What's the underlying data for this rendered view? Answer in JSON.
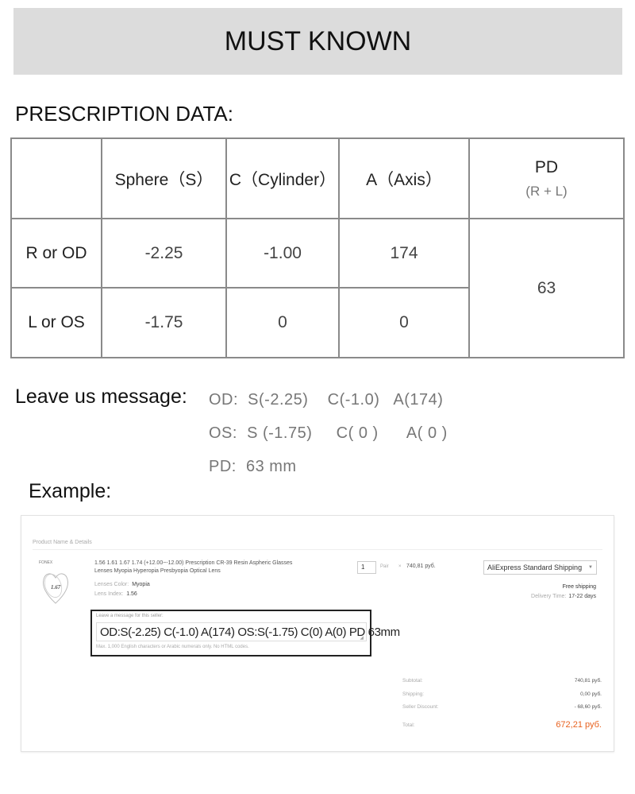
{
  "banner": {
    "title": "MUST KNOWN"
  },
  "prescription": {
    "section_title": "PRESCRIPTION DATA:",
    "headers": {
      "corner": "",
      "sphere": "Sphere（S）",
      "cylinder": "C（Cylinder）",
      "axis": "A（Axis）",
      "pd": "PD",
      "pd_sub": "(R + L)"
    },
    "rows": [
      {
        "label": "R or OD",
        "sphere": "-2.25",
        "cylinder": "-1.00",
        "axis": "174"
      },
      {
        "label": "L or OS",
        "sphere": "-1.75",
        "cylinder": "0",
        "axis": "0"
      }
    ],
    "pd_value": "63"
  },
  "message_guide": {
    "label": "Leave us message:",
    "lines": [
      "OD:  S(-2.25)    C(-1.0)   A(174)",
      "OS:  S (-1.75)     C( 0 )      A( 0 )",
      "PD:  63 mm"
    ]
  },
  "example": {
    "label": "Example:",
    "section_header": "Product Name & Details",
    "thumbnail": {
      "brand": "FONEX",
      "index_text": "1.67"
    },
    "product_title": "1.56 1.61 1.67 1.74 (+12.00~-12.00) Prescription CR-39 Resin Aspheric Glasses Lenses Myopia Hyperopia Presbyopia Optical Lens",
    "attributes": [
      {
        "key": "Lenses Color:",
        "value": "Myopia"
      },
      {
        "key": "Lens Index:",
        "value": "1.56"
      }
    ],
    "quantity": "1",
    "unit": "Pair",
    "times": "×",
    "unit_price": "740,81 руб.",
    "shipping_method": "AliExpress Standard Shipping",
    "free_shipping": "Free shipping",
    "delivery_time_label": "Delivery Time:",
    "delivery_time_value": "17-22 days",
    "message_box": {
      "label": "Leave a message for this seller:",
      "value": "OD:S(-2.25) C(-1.0) A(174)    OS:S(-1.75) C(0) A(0)   PD  63mm",
      "hint": "Max. 1,000 English characters or Arabic numerals only. No HTML codes."
    },
    "summary": [
      {
        "key": "Subtotal:",
        "value": "740,81 руб."
      },
      {
        "key": "Shipping:",
        "value": "0,00 руб."
      },
      {
        "key": "Seller Discount:",
        "value": "- 68,60 руб."
      },
      {
        "key": "Total:",
        "value": "672,21 руб."
      }
    ],
    "colors": {
      "total_accent": "#e8621f"
    }
  }
}
